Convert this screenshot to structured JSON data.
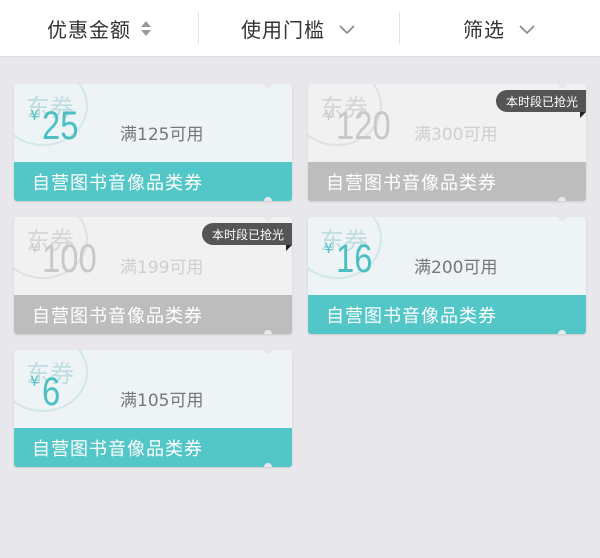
{
  "filters": {
    "discount": "优惠金额",
    "threshold": "使用门槛",
    "filter": "筛选"
  },
  "coupons": [
    {
      "stamp": "东券",
      "currency": "¥",
      "amount": "25",
      "condition": "满125可用",
      "category": "自营图书音像品类券",
      "status": ""
    },
    {
      "stamp": "东券",
      "currency": "¥",
      "amount": "120",
      "condition": "满300可用",
      "category": "自营图书音像品类券",
      "status": "本时段已抢光"
    },
    {
      "stamp": "东券",
      "currency": "¥",
      "amount": "100",
      "condition": "满199可用",
      "category": "自营图书音像品类券",
      "status": "本时段已抢光"
    },
    {
      "stamp": "东券",
      "currency": "¥",
      "amount": "16",
      "condition": "满200可用",
      "category": "自营图书音像品类券",
      "status": ""
    },
    {
      "stamp": "东券",
      "currency": "¥",
      "amount": "6",
      "condition": "满105可用",
      "category": "自营图书音像品类券",
      "status": ""
    }
  ],
  "colors": {
    "accent": "#53c6c8",
    "disabled": "#bdbdbd",
    "badge": "#555555"
  }
}
